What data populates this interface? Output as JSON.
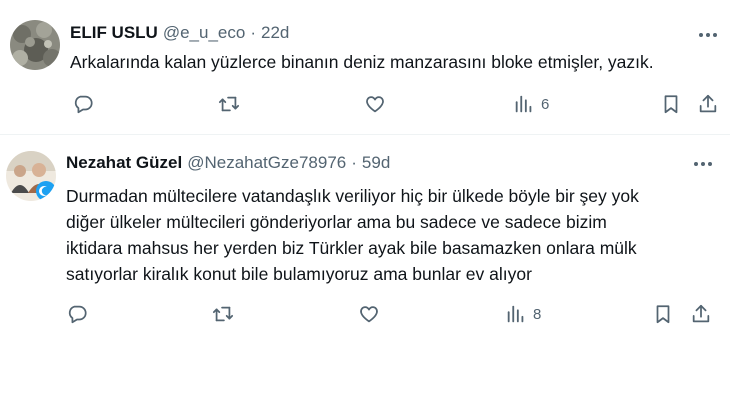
{
  "tweets": [
    {
      "author_name": "ELIF USLU",
      "handle": "@e_u_eco",
      "separator": "·",
      "time": "22d",
      "text_lines": [
        "Arkalarında kalan yüzlerce binanın deniz manzarasını bloke etmişler, yazık."
      ],
      "actions": {
        "reply_icon": "reply-icon",
        "retweet_icon": "retweet-icon",
        "like_icon": "heart-icon",
        "views_icon": "views-chart-icon",
        "views_count": "6",
        "bookmark_icon": "bookmark-icon",
        "share_icon": "share-icon"
      }
    },
    {
      "author_name": "Nezahat Güzel",
      "handle": "@NezahatGze78976",
      "separator": "·",
      "time": "59d",
      "text_lines": [
        "Durmadan mültecilere vatandaşlık veriliyor hiç bir ülkede böyle bir şey yok",
        "diğer ülkeler mültecileri gönderiyorlar ama bu sadece ve sadece bizim",
        "iktidara mahsus her yerden biz Türkler ayak bile basamazken onlara mülk",
        "satıyorlar kiralık konut bile bulamıyoruz ama bunlar ev alıyor"
      ],
      "actions": {
        "reply_icon": "reply-icon",
        "retweet_icon": "retweet-icon",
        "like_icon": "heart-icon",
        "views_icon": "views-chart-icon",
        "views_count": "8",
        "bookmark_icon": "bookmark-icon",
        "share_icon": "share-icon"
      }
    }
  ],
  "colors": {
    "text": "#0f1419",
    "secondary": "#536471",
    "divider": "#eff3f4"
  }
}
